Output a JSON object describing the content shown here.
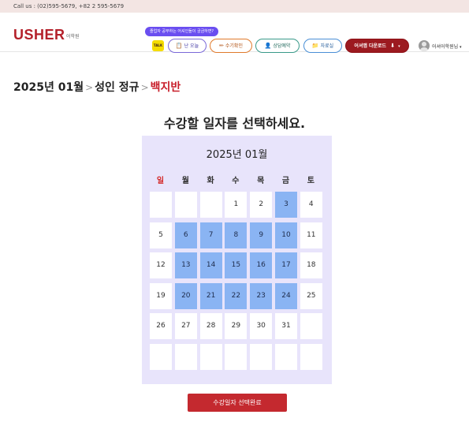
{
  "topbar": {
    "contact": "Call us : (02)595-5679, +82 2 595-5679"
  },
  "header": {
    "logo": "USHER",
    "logo_sub": "어학원",
    "tooltip": "졸업자 공부하는 어셔인들이 궁금하면?",
    "kakao_label": "TALK",
    "nav": [
      {
        "label": "난 오늘",
        "icon": "notepad-icon"
      },
      {
        "label": "수기확인",
        "icon": "pencil-icon"
      },
      {
        "label": "상담예약",
        "icon": "person-icon"
      },
      {
        "label": "자료실",
        "icon": "folder-icon"
      },
      {
        "label": "어셔앱 다운로드",
        "icon": "download-icon"
      }
    ],
    "user": "어셔어학원님"
  },
  "breadcrumb": {
    "items": [
      "2025년 01월",
      "성인 정규"
    ],
    "current": "백지반",
    "separator": ">"
  },
  "page_title": "수강할 일자를 선택하세요.",
  "calendar": {
    "month_label": "2025년 01월",
    "weekdays": [
      "일",
      "월",
      "화",
      "수",
      "목",
      "금",
      "토"
    ],
    "weeks": [
      [
        "",
        "",
        "",
        "1",
        "2",
        "3",
        "4"
      ],
      [
        "5",
        "6",
        "7",
        "8",
        "9",
        "10",
        "11"
      ],
      [
        "12",
        "13",
        "14",
        "15",
        "16",
        "17",
        "18"
      ],
      [
        "19",
        "20",
        "21",
        "22",
        "23",
        "24",
        "25"
      ],
      [
        "26",
        "27",
        "28",
        "29",
        "30",
        "31",
        ""
      ],
      [
        "",
        "",
        "",
        "",
        "",
        "",
        ""
      ]
    ],
    "available_days": [
      "3",
      "6",
      "7",
      "8",
      "9",
      "10",
      "13",
      "14",
      "15",
      "16",
      "17",
      "20",
      "21",
      "22",
      "23",
      "24"
    ],
    "available_color": "#8ab4f3",
    "background_color": "#e8e4fb"
  },
  "confirm_button": {
    "label": "수강일자 선택완료"
  },
  "colors": {
    "brand": "#b4202a",
    "button": "#c4292f",
    "accent_purple": "#6a4ef0"
  }
}
